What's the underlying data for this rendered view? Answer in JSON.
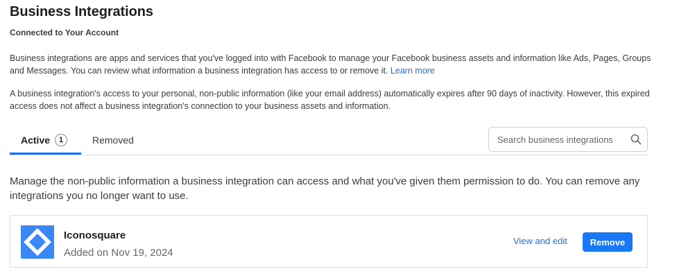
{
  "header": {
    "title": "Business Integrations",
    "subtitle": "Connected to Your Account"
  },
  "info": {
    "para1_text": "Business integrations are apps and services that you've logged into with Facebook to manage your Facebook business assets and information like Ads, Pages, Groups and Messages. You can review what information a business integration has access to or remove it.",
    "para1_link": "Learn more",
    "para2_text": "A business integration's access to your personal, non-public information (like your email address) automatically expires after 90 days of inactivity. However, this expired access does not affect a business integration's connection to your business assets and information."
  },
  "tabs": {
    "active_label": "Active",
    "active_count": "1",
    "removed_label": "Removed"
  },
  "search": {
    "placeholder": "Search business integrations",
    "value": ""
  },
  "manage_text": "Manage the non-public information a business integration can access and what you've given them permission to do. You can remove any integrations you no longer want to use.",
  "integrations": [
    {
      "name": "Iconosquare",
      "added": "Added on Nov 19, 2024",
      "view_edit_label": "View and edit",
      "remove_label": "Remove",
      "logo_icon": "iconosquare-logo-icon",
      "logo_color": "#3b87f4"
    }
  ],
  "colors": {
    "accent": "#1877f2",
    "link": "#216fdb",
    "border": "#dadde1"
  }
}
